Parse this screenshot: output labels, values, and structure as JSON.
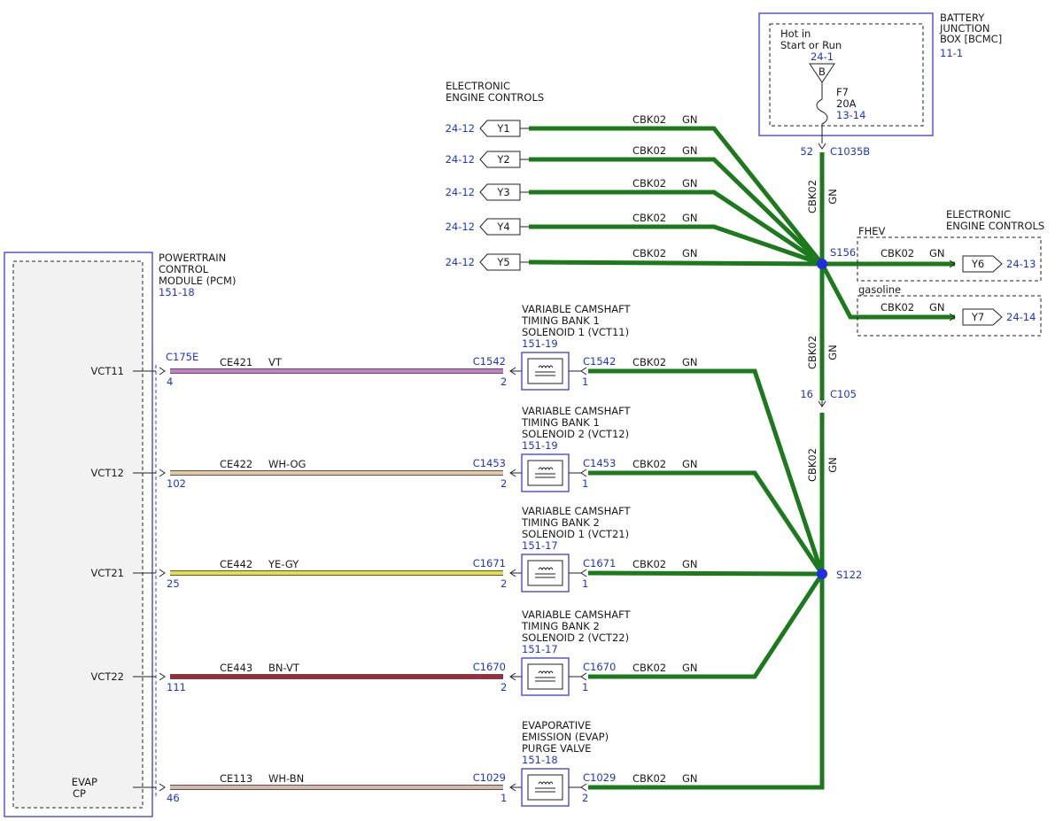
{
  "battery_box": {
    "title": [
      "BATTERY",
      "JUNCTION",
      "BOX [BCMC]"
    ],
    "ref": "11-1",
    "hot_in": [
      "Hot in",
      "Start or Run"
    ],
    "hot_ref": "24-1",
    "bus": "B",
    "fuse": "F7",
    "fuse_rating": "20A",
    "fuse_ref": "13-14",
    "pin": "52",
    "connector": "C1035B"
  },
  "eec_top": {
    "title": [
      "ELECTRONIC",
      "ENGINE CONTROLS"
    ]
  },
  "eec_right": {
    "title": [
      "ELECTRONIC",
      "ENGINE CONTROLS"
    ]
  },
  "y_refs": [
    {
      "label": "Y1",
      "ref": "24-12",
      "circuit": "CBK02",
      "color": "GN"
    },
    {
      "label": "Y2",
      "ref": "24-12",
      "circuit": "CBK02",
      "color": "GN"
    },
    {
      "label": "Y3",
      "ref": "24-12",
      "circuit": "CBK02",
      "color": "GN"
    },
    {
      "label": "Y4",
      "ref": "24-12",
      "circuit": "CBK02",
      "color": "GN"
    },
    {
      "label": "Y5",
      "ref": "24-12",
      "circuit": "CBK02",
      "color": "GN"
    }
  ],
  "splices": {
    "s156": "S156",
    "s122": "S122"
  },
  "vertical_wire": {
    "circuit": "CBK02",
    "color": "GN"
  },
  "c105": {
    "pin": "16",
    "connector": "C105"
  },
  "fhev": {
    "label": "FHEV",
    "circuit": "CBK02",
    "color": "GN",
    "tag": "Y6",
    "ref": "24-13"
  },
  "gasoline": {
    "label": "gasoline",
    "circuit": "CBK02",
    "color": "GN",
    "tag": "Y7",
    "ref": "24-14"
  },
  "pcm": {
    "title": [
      "POWERTRAIN",
      "CONTROL",
      "MODULE (PCM)"
    ],
    "ref": "151-18",
    "connector": "C175E",
    "pins": [
      {
        "label": "VCT11",
        "pin": "4"
      },
      {
        "label": "VCT12",
        "pin": "102"
      },
      {
        "label": "VCT21",
        "pin": "25"
      },
      {
        "label": "VCT22",
        "pin": "111"
      },
      {
        "label": "EVAP",
        "label2": "CP",
        "pin": "46"
      }
    ]
  },
  "circuits": [
    {
      "pcm_circuit": "CE421",
      "pcm_color": "VT",
      "wire_color": "#c97ac9",
      "comp_title": [
        "VARIABLE CAMSHAFT",
        "TIMING BANK 1",
        "SOLENOID 1 (VCT11)"
      ],
      "comp_ref": "151-19",
      "conn": "C1542",
      "left_pin": "2",
      "right_pin": "1",
      "gn_circuit": "CBK02",
      "gn_color": "GN"
    },
    {
      "pcm_circuit": "CE422",
      "pcm_color": "WH-OG",
      "wire_color": "#e6c8a0",
      "comp_title": [
        "VARIABLE CAMSHAFT",
        "TIMING BANK 1",
        "SOLENOID 2 (VCT12)"
      ],
      "comp_ref": "151-19",
      "conn": "C1453",
      "left_pin": "2",
      "right_pin": "1",
      "gn_circuit": "CBK02",
      "gn_color": "GN"
    },
    {
      "pcm_circuit": "CE442",
      "pcm_color": "YE-GY",
      "wire_color": "#e8e03a",
      "comp_title": [
        "VARIABLE CAMSHAFT",
        "TIMING BANK 2",
        "SOLENOID 1 (VCT21)"
      ],
      "comp_ref": "151-17",
      "conn": "C1671",
      "left_pin": "2",
      "right_pin": "1",
      "gn_circuit": "CBK02",
      "gn_color": "GN"
    },
    {
      "pcm_circuit": "CE443",
      "pcm_color": "BN-VT",
      "wire_color": "#a8273a",
      "comp_title": [
        "VARIABLE CAMSHAFT",
        "TIMING BANK 2",
        "SOLENOID 2 (VCT22)"
      ],
      "comp_ref": "151-17",
      "conn": "C1670",
      "left_pin": "2",
      "right_pin": "1",
      "gn_circuit": "CBK02",
      "gn_color": "GN"
    },
    {
      "pcm_circuit": "CE113",
      "pcm_color": "WH-BN",
      "wire_color": "#d8b8a8",
      "comp_title": [
        "EVAPORATIVE",
        "EMISSION (EVAP)",
        "PURGE VALVE"
      ],
      "comp_ref": "151-18",
      "conn": "C1029",
      "left_pin": "1",
      "right_pin": "2",
      "gn_circuit": "CBK02",
      "gn_color": "GN"
    }
  ],
  "colors": {
    "wire_gn": "#1c7a1c",
    "box": "#3b3bd6",
    "ref_text": "#1f35c8",
    "splice": "#1f2fe0"
  }
}
